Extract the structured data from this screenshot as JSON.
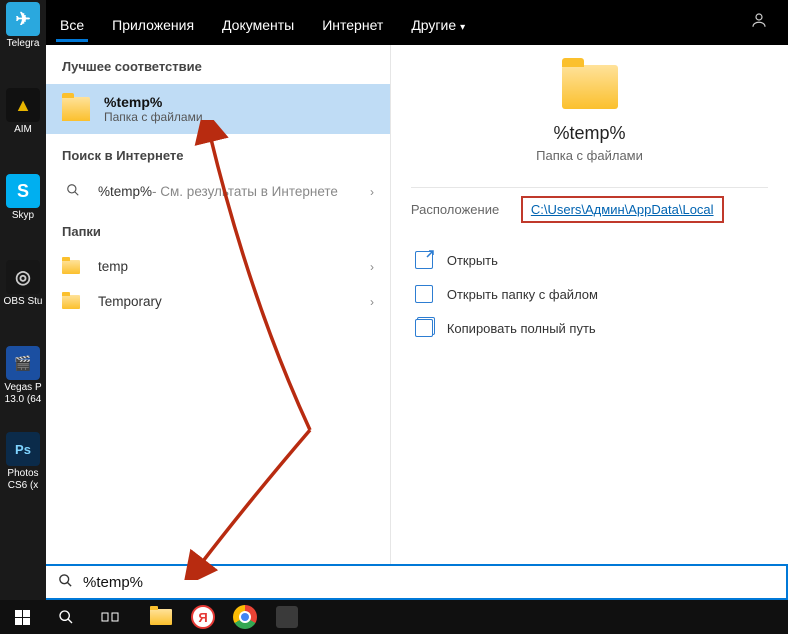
{
  "desktop": {
    "icons": [
      {
        "label": "Telegra",
        "bg": "#2aa8de",
        "glyph": "✈"
      },
      {
        "label": "AIM",
        "bg": "#111",
        "glyph": "▲",
        "glyphColor": "#e8b500"
      },
      {
        "label": "Skyp",
        "bg": "#00aff0",
        "glyph": "S"
      },
      {
        "label": "OBS Stu",
        "bg": "#161616",
        "glyph": "◎"
      },
      {
        "label": "Vegas P\n13.0 (64",
        "bg": "#1b4fa1",
        "glyph": "🎬"
      },
      {
        "label": "Photos\nCS6 (x",
        "bg": "#0b2b4a",
        "glyph": "Ps"
      }
    ]
  },
  "filters": {
    "items": [
      {
        "label": "Все",
        "active": true
      },
      {
        "label": "Приложения"
      },
      {
        "label": "Документы"
      },
      {
        "label": "Интернет"
      },
      {
        "label": "Другие",
        "dropdown": true
      }
    ]
  },
  "left": {
    "best_header": "Лучшее соответствие",
    "best_match": {
      "title": "%temp%",
      "sub": "Папка с файлами"
    },
    "web_header": "Поиск в Интернете",
    "web_row": {
      "term": "%temp%",
      "suffix": " - См. результаты в Интернете"
    },
    "folders_header": "Папки",
    "folders": [
      {
        "name": "temp"
      },
      {
        "name": "Temporary"
      }
    ]
  },
  "right": {
    "title": "%temp%",
    "sub": "Папка с файлами",
    "location_label": "Расположение",
    "location_value": "C:\\Users\\Админ\\AppData\\Local",
    "actions": [
      {
        "label": "Открыть"
      },
      {
        "label": "Открыть папку с файлом"
      },
      {
        "label": "Копировать полный путь"
      }
    ]
  },
  "search": {
    "value": "%temp%"
  },
  "taskbar": {
    "apps": [
      {
        "name": "explorer",
        "color": "#f7c35a"
      },
      {
        "name": "yandex",
        "color": "#fff",
        "border": "#e53935",
        "glyph": "Y"
      },
      {
        "name": "chrome"
      },
      {
        "name": "settings",
        "color": "#444"
      }
    ]
  }
}
